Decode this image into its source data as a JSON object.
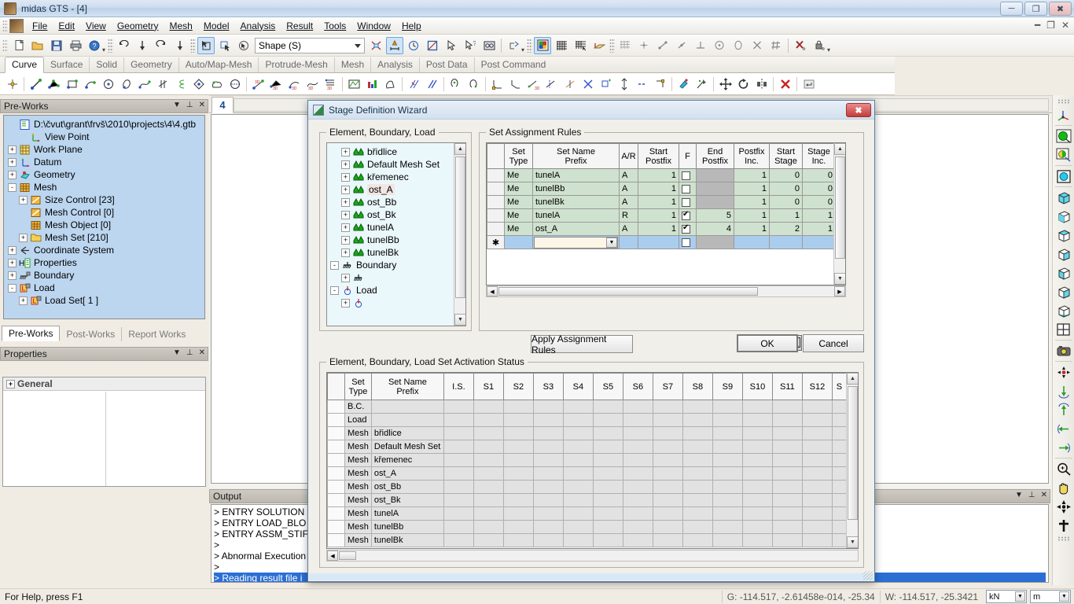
{
  "window": {
    "title": "midas GTS - [4]",
    "app_icon": "app-icon",
    "minimize": "–",
    "maximize": "❐",
    "close": "✕",
    "mdi_minimize": "–",
    "mdi_restore": "❐",
    "mdi_close": "✕"
  },
  "menu": {
    "items": [
      {
        "label": "File"
      },
      {
        "label": "Edit"
      },
      {
        "label": "View"
      },
      {
        "label": "Geometry"
      },
      {
        "label": "Mesh"
      },
      {
        "label": "Model"
      },
      {
        "label": "Analysis"
      },
      {
        "label": "Result"
      },
      {
        "label": "Tools"
      },
      {
        "label": "Window"
      },
      {
        "label": "Help"
      }
    ]
  },
  "toolbar": {
    "shape_combo_value": "Shape (S)",
    "groups": [
      {
        "name": "file",
        "icons": [
          "new-file-icon",
          "open-folder-icon",
          "save-icon",
          "print-icon",
          "help-icon"
        ]
      },
      {
        "name": "undo-redo",
        "icons": [
          "undo-icon",
          "undo-down-icon",
          "redo-icon",
          "redo-down-icon"
        ]
      },
      {
        "name": "select",
        "icons": [
          "select-shape-icon",
          "select-node-icon",
          "select-circle-icon"
        ]
      },
      {
        "name": "filter",
        "icons": [
          "filter-icon",
          "dimension-icon",
          "clock-icon",
          "window-select-icon",
          "arrow-icon",
          "query-icon",
          "find-icon",
          "extrude-icon"
        ]
      },
      {
        "name": "display",
        "icons": [
          "render-icon",
          "grid-icon",
          "grid-snap-icon",
          "workplane-icon"
        ]
      },
      {
        "name": "snap",
        "icons": [
          "grid-gray-icon",
          "snap-point-icon",
          "snap-line-icon",
          "snap-mid-icon",
          "snap-perp-icon",
          "snap-center-icon",
          "snap-quad-icon",
          "snap-intersect-icon",
          "snap-grid-icon",
          "snap-off-icon",
          "lock-icon"
        ]
      }
    ]
  },
  "ribbon": {
    "tabs": [
      {
        "label": "Curve",
        "active": true
      },
      {
        "label": "Surface",
        "active": false
      },
      {
        "label": "Solid",
        "active": false
      },
      {
        "label": "Geometry",
        "active": false
      },
      {
        "label": "Auto/Map-Mesh",
        "active": false
      },
      {
        "label": "Protrude-Mesh",
        "active": false
      },
      {
        "label": "Mesh",
        "active": false
      },
      {
        "label": "Analysis",
        "active": false
      },
      {
        "label": "Post Data",
        "active": false
      },
      {
        "label": "Post Command",
        "active": false
      }
    ],
    "icons": [
      "point-icon",
      "sep",
      "line-icon",
      "polyline-icon",
      "rectangle-icon",
      "arc-icon",
      "circle-icon",
      "ellipse-icon",
      "spline-icon",
      "cross-curve-icon",
      "helix-icon",
      "diamond-icon",
      "cloud-icon",
      "ellipse2-icon",
      "sep",
      "line3d-icon",
      "polyline3d-icon",
      "arc3d-icon",
      "spline3d-icon",
      "profile3d-icon",
      "sep",
      "section-icon",
      "chart-icon",
      "extrude-curve-icon",
      "sep",
      "intersect-icon",
      "parallel-icon",
      "sep",
      "project-icon",
      "project2-icon",
      "sep",
      "fillet-icon",
      "chamfer-icon",
      "trim-icon",
      "trim3d-icon",
      "divide-icon",
      "cross-trim-icon",
      "offset-icon",
      "scale-icon",
      "dash-icon",
      "corner-icon",
      "sep",
      "paint-icon",
      "sweep-icon",
      "sep",
      "move-icon",
      "rotate-icon",
      "mirror-icon",
      "sep",
      "delete-icon",
      "sep",
      "enter-icon"
    ]
  },
  "preworks": {
    "title": "Pre-Works",
    "header_buttons": [
      "chevron-down-icon",
      "pin-icon",
      "close-icon"
    ],
    "tree": [
      {
        "indent": 0,
        "pm": "",
        "icon": "document-icon",
        "label": "D:\\čvut\\grant\\frvš\\2010\\projects\\4\\4.gtb"
      },
      {
        "indent": 1,
        "pm": "",
        "icon": "viewpoint-icon",
        "label": "View Point"
      },
      {
        "indent": 1,
        "pm": "+",
        "icon": "workplane-icon",
        "label": "Work Plane"
      },
      {
        "indent": 1,
        "pm": "+",
        "icon": "datum-icon",
        "label": "Datum"
      },
      {
        "indent": 1,
        "pm": "+",
        "icon": "geometry-icon",
        "label": "Geometry"
      },
      {
        "indent": 1,
        "pm": "-",
        "icon": "mesh-icon",
        "label": "Mesh"
      },
      {
        "indent": 2,
        "pm": "+",
        "icon": "size-control-icon",
        "label": "Size Control [23]"
      },
      {
        "indent": 2,
        "pm": "",
        "icon": "mesh-control-icon",
        "label": "Mesh Control [0]"
      },
      {
        "indent": 2,
        "pm": "",
        "icon": "mesh-object-icon",
        "label": "Mesh Object [0]"
      },
      {
        "indent": 2,
        "pm": "+",
        "icon": "folder-icon",
        "label": "Mesh Set [210]"
      },
      {
        "indent": 1,
        "pm": "+",
        "icon": "coordsys-icon",
        "label": "Coordinate System"
      },
      {
        "indent": 1,
        "pm": "+",
        "icon": "properties-icon",
        "label": "Properties"
      },
      {
        "indent": 1,
        "pm": "+",
        "icon": "boundary-icon",
        "label": "Boundary"
      },
      {
        "indent": 1,
        "pm": "-",
        "icon": "load-icon",
        "label": "Load"
      },
      {
        "indent": 2,
        "pm": "+",
        "icon": "loadset-icon",
        "label": "Load Set[ 1 ]"
      }
    ],
    "tabs": [
      {
        "label": "Pre-Works",
        "active": true
      },
      {
        "label": "Post-Works",
        "active": false
      },
      {
        "label": "Report Works",
        "active": false
      }
    ]
  },
  "properties": {
    "title": "Properties",
    "header_buttons": [
      "chevron-down-icon",
      "pin-icon",
      "close-icon"
    ],
    "general_label": "General",
    "general_pm": "+"
  },
  "document": {
    "tab_label": "4"
  },
  "output": {
    "title": "Output",
    "header_buttons": [
      "chevron-down-icon",
      "pin-icon",
      "close-icon"
    ],
    "lines": [
      {
        "text": "> ENTRY SOLUTION",
        "selected": false
      },
      {
        "text": "> ENTRY LOAD_BLO",
        "selected": false
      },
      {
        "text": "> ENTRY ASSM_STIF",
        "selected": false
      },
      {
        "text": ">",
        "selected": false
      },
      {
        "text": "> Abnormal Execution",
        "selected": false
      },
      {
        "text": ">",
        "selected": false
      },
      {
        "text": "> Reading result file i",
        "selected": true
      }
    ]
  },
  "right_toolbar": {
    "icons": [
      "coord-axes-icon",
      "sep",
      "shade-icon",
      "hidden-line-icon",
      "sep",
      "wireframe-icon",
      "sep",
      "iso-view-icon",
      "front-view-icon",
      "top-view-icon",
      "right-view-icon",
      "left-view-icon",
      "back-view-icon",
      "bottom-view-icon",
      "four-view-icon",
      "sep",
      "camera-icon",
      "sep",
      "rotate-free-icon",
      "rotate-down-icon",
      "rotate-up-icon",
      "rotate-left-icon",
      "rotate-right-icon",
      "sep",
      "zoom-icon",
      "pan-hand-icon",
      "dynamic-rotate-icon",
      "fit-icon"
    ]
  },
  "statusbar": {
    "help_text": "For Help, press F1",
    "global_coords": "G: -114.517, -2.61458e-014, -25.34",
    "work_coords": "W: -114.517, -25.3421",
    "force_unit": "kN",
    "length_unit": "m"
  },
  "dialog": {
    "title": "Stage Definition Wizard",
    "close_label": "✖",
    "groups": {
      "ebl": "Element, Boundary, Load",
      "rules": "Set Assignment Rules",
      "status": "Element, Boundary, Load Set Activation Status"
    },
    "tree": [
      {
        "indent": 2,
        "pm": "+",
        "icon": "mesh-set-icon",
        "label": "břidlice",
        "selected": false
      },
      {
        "indent": 2,
        "pm": "+",
        "icon": "mesh-set-icon",
        "label": "Default Mesh Set",
        "selected": false
      },
      {
        "indent": 2,
        "pm": "+",
        "icon": "mesh-set-icon",
        "label": "křemenec",
        "selected": false
      },
      {
        "indent": 2,
        "pm": "+",
        "icon": "mesh-set-icon",
        "label": "ost_A",
        "selected": true
      },
      {
        "indent": 2,
        "pm": "+",
        "icon": "mesh-set-icon",
        "label": "ost_Bb",
        "selected": false
      },
      {
        "indent": 2,
        "pm": "+",
        "icon": "mesh-set-icon",
        "label": "ost_Bk",
        "selected": false
      },
      {
        "indent": 2,
        "pm": "+",
        "icon": "mesh-set-icon",
        "label": "tunelA",
        "selected": false
      },
      {
        "indent": 2,
        "pm": "+",
        "icon": "mesh-set-icon",
        "label": "tunelBb",
        "selected": false
      },
      {
        "indent": 2,
        "pm": "+",
        "icon": "mesh-set-icon",
        "label": "tunelBk",
        "selected": false
      },
      {
        "indent": 1,
        "pm": "-",
        "icon": "boundary-icon",
        "label": "Boundary",
        "selected": false
      },
      {
        "indent": 2,
        "pm": "+",
        "icon": "boundary-icon",
        "label": "",
        "selected": false
      },
      {
        "indent": 1,
        "pm": "-",
        "icon": "load-circle-icon",
        "label": "Load",
        "selected": false
      },
      {
        "indent": 2,
        "pm": "+",
        "icon": "load-circle-icon",
        "label": "",
        "selected": false
      }
    ],
    "rules_table": {
      "headers": [
        "",
        "Set\nType",
        "Set Name\nPrefix",
        "A/R",
        "Start\nPostfix",
        "F",
        "End\nPostfix",
        "Postfix\nInc.",
        "Start\nStage",
        "Stage\nInc."
      ],
      "header_lines": [
        [
          "",
          ""
        ],
        [
          "Set",
          "Type"
        ],
        [
          "Set Name",
          "Prefix"
        ],
        [
          "A/R",
          ""
        ],
        [
          "Start",
          "Postfix"
        ],
        [
          "F",
          ""
        ],
        [
          "End",
          "Postfix"
        ],
        [
          "Postfix",
          "Inc."
        ],
        [
          "Start",
          "Stage"
        ],
        [
          "Stage",
          "Inc."
        ]
      ],
      "rows": [
        {
          "set_type": "Me",
          "prefix": "tunelA",
          "ar": "A",
          "start_postfix": "1",
          "f": false,
          "end_postfix": "",
          "postfix_inc": "1",
          "start_stage": "0",
          "stage_inc": "0"
        },
        {
          "set_type": "Me",
          "prefix": "tunelBb",
          "ar": "A",
          "start_postfix": "1",
          "f": false,
          "end_postfix": "",
          "postfix_inc": "1",
          "start_stage": "0",
          "stage_inc": "0"
        },
        {
          "set_type": "Me",
          "prefix": "tunelBk",
          "ar": "A",
          "start_postfix": "1",
          "f": false,
          "end_postfix": "",
          "postfix_inc": "1",
          "start_stage": "0",
          "stage_inc": "0"
        },
        {
          "set_type": "Me",
          "prefix": "tunelA",
          "ar": "R",
          "start_postfix": "1",
          "f": true,
          "end_postfix": "5",
          "postfix_inc": "1",
          "start_stage": "1",
          "stage_inc": "1"
        },
        {
          "set_type": "Me",
          "prefix": "ost_A",
          "ar": "A",
          "start_postfix": "1",
          "f": true,
          "end_postfix": "4",
          "postfix_inc": "1",
          "start_stage": "2",
          "stage_inc": "1"
        }
      ],
      "new_row_marker": "✱"
    },
    "buttons": {
      "apply": "Apply Assignment Rules",
      "ok": "OK",
      "cancel": "Cancel",
      "stage_icon": "stage-view-icon"
    },
    "status_table": {
      "header_lines": [
        [
          "",
          ""
        ],
        [
          "Set",
          "Type"
        ],
        [
          "Set Name",
          "Prefix"
        ]
      ],
      "stage_columns": [
        "I.S.",
        "S1",
        "S2",
        "S3",
        "S4",
        "S5",
        "S6",
        "S7",
        "S8",
        "S9",
        "S10",
        "S11",
        "S12",
        "S"
      ],
      "rows": [
        {
          "set_type": "B.C.",
          "prefix": ""
        },
        {
          "set_type": "Load",
          "prefix": ""
        },
        {
          "set_type": "Mesh",
          "prefix": "břidlice"
        },
        {
          "set_type": "Mesh",
          "prefix": "Default Mesh Set"
        },
        {
          "set_type": "Mesh",
          "prefix": "křemenec"
        },
        {
          "set_type": "Mesh",
          "prefix": "ost_A"
        },
        {
          "set_type": "Mesh",
          "prefix": "ost_Bb"
        },
        {
          "set_type": "Mesh",
          "prefix": "ost_Bk"
        },
        {
          "set_type": "Mesh",
          "prefix": "tunelA"
        },
        {
          "set_type": "Mesh",
          "prefix": "tunelBb"
        },
        {
          "set_type": "Mesh",
          "prefix": "tunelBk"
        }
      ]
    }
  }
}
